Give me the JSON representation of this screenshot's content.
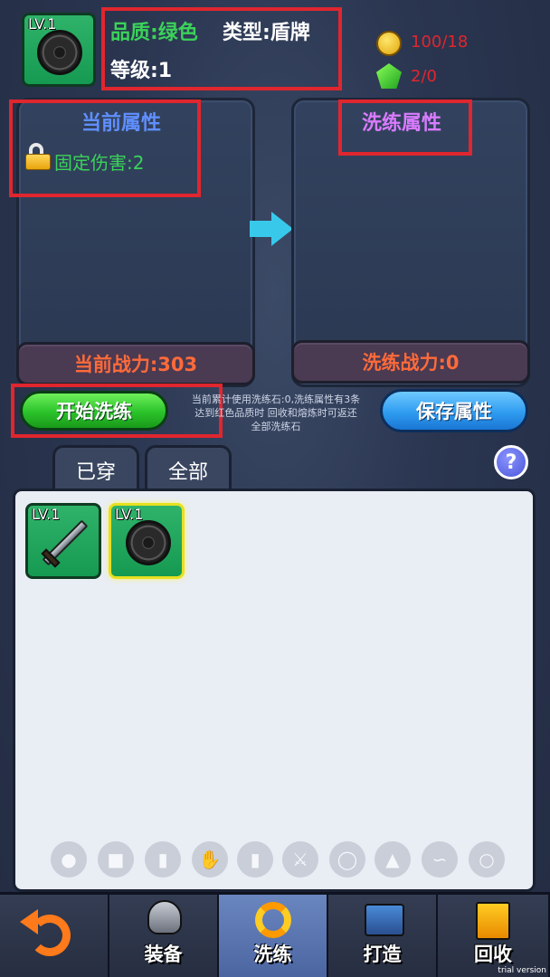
{
  "header": {
    "level_badge": "LV.1",
    "quality": "品质:绿色",
    "type": "类型:盾牌",
    "level": "等级:1",
    "gold": "100/18",
    "gems": "2/0"
  },
  "left_panel": {
    "title": "当前属性",
    "attribute": "固定伤害:2",
    "power": "当前战力:303"
  },
  "right_panel": {
    "title": "洗练属性",
    "power": "洗练战力:0"
  },
  "actions": {
    "start_label": "开始洗练",
    "save_label": "保存属性",
    "info_line1": "当前累计使用洗练石:0,洗练属性有3条",
    "info_line2": "达到红色品质时 回收和熔炼时可返还",
    "info_line3": "全部洗练石"
  },
  "tabs": [
    {
      "label": "已穿"
    },
    {
      "label": "全部"
    }
  ],
  "inventory": [
    {
      "level": "LV.1",
      "icon": "sword-icon",
      "selected": false
    },
    {
      "level": "LV.1",
      "icon": "shield-icon",
      "selected": true
    }
  ],
  "filters": [
    "helmet-icon",
    "armor-icon",
    "pants-icon",
    "glove-icon",
    "boot-icon",
    "sword-icon",
    "shield-icon",
    "bracer-icon",
    "necklace-icon",
    "ring-icon"
  ],
  "nav": {
    "back": "back-icon",
    "equip": "装备",
    "reforge": "洗练",
    "forge": "打造",
    "recycle": "回收"
  },
  "watermark": "trial version",
  "colors": {
    "quality_green": "#3bd25a",
    "title_blue": "#5f8fff",
    "title_purple": "#d97bff",
    "power_orange": "#ff6a3a",
    "currency_red": "#e0262e"
  }
}
